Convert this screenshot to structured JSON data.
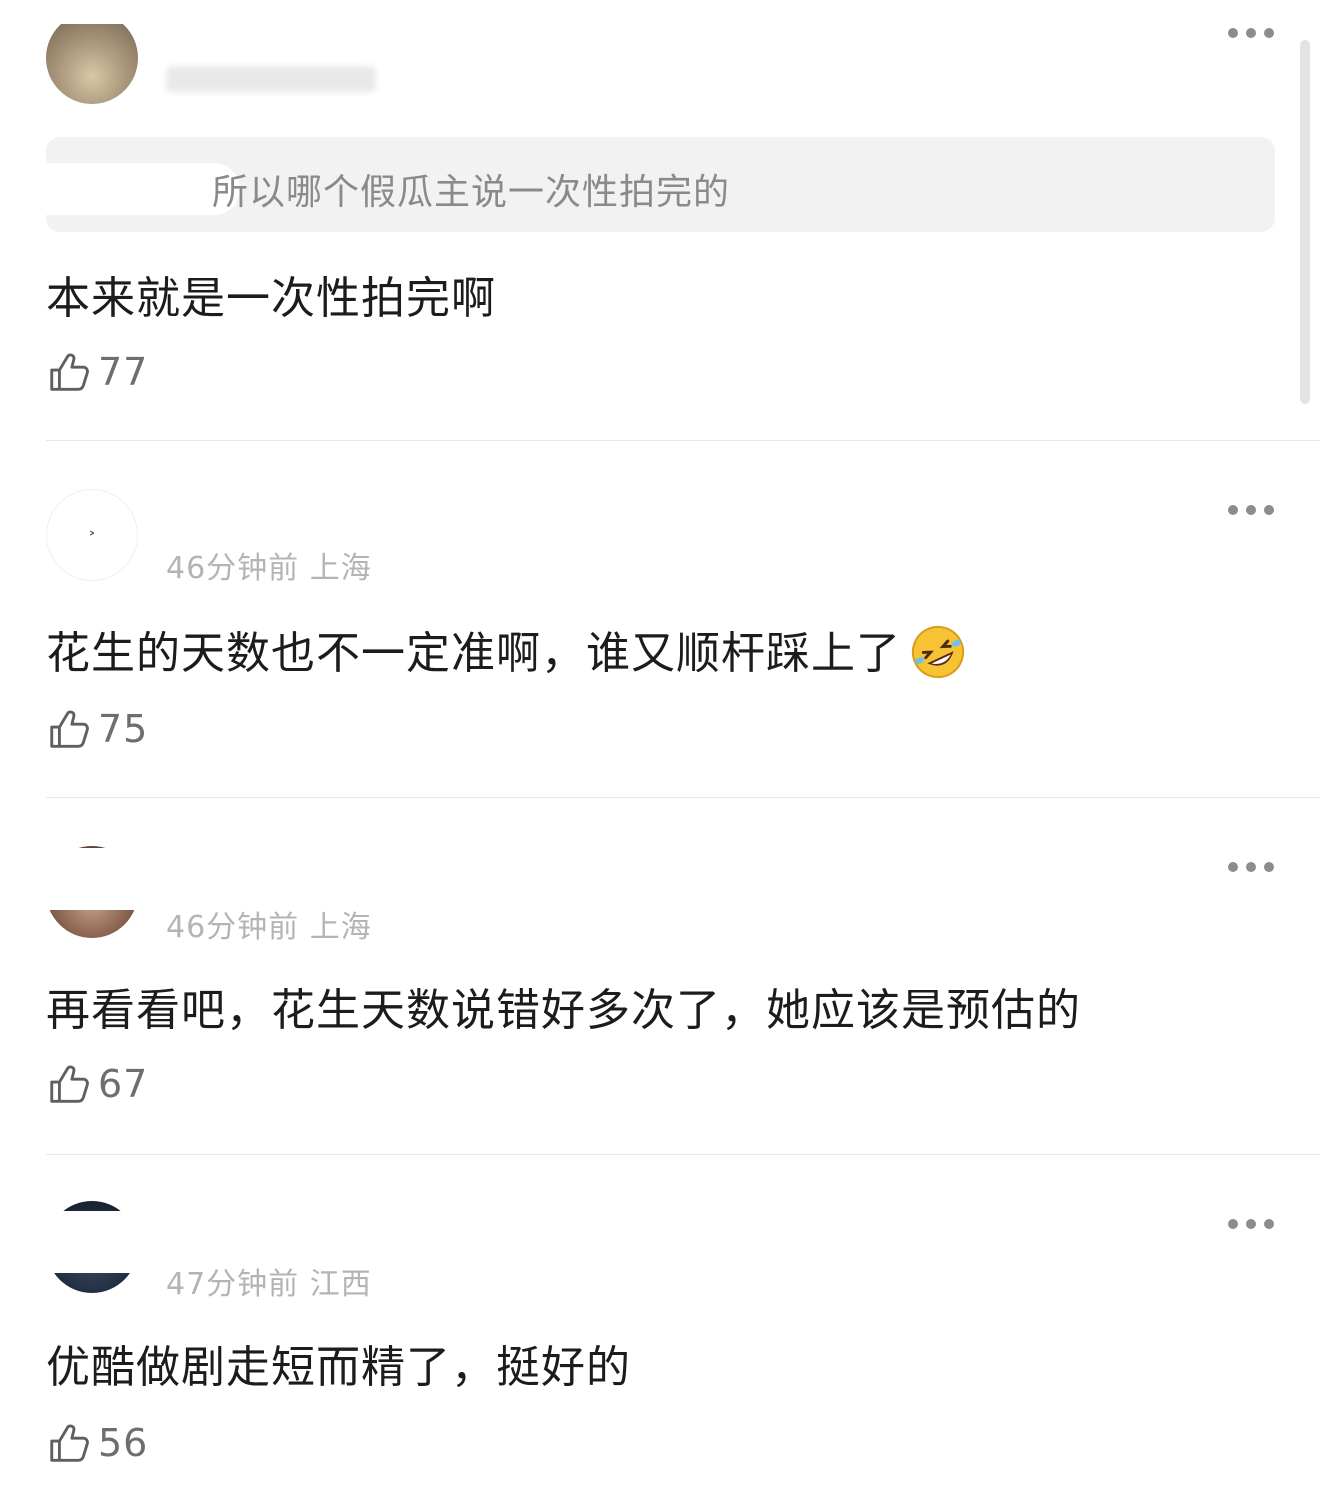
{
  "comments": [
    {
      "time": "",
      "location": "",
      "quoted": "所以哪个假瓜主说一次性拍完的",
      "text": "本来就是一次性拍完啊",
      "likes": "77",
      "avatar_color": "#8a7b6a"
    },
    {
      "time": "46分钟前",
      "location": "上海",
      "text": "花生的天数也不一定准啊，谁又顺杆踩上了",
      "emoji": "rolling-on-floor-laughing-emoji",
      "likes": "75",
      "avatar_color": "#ffffff"
    },
    {
      "time": "46分钟前",
      "location": "上海",
      "text": "再看看吧，花生天数说错好多次了，她应该是预估的",
      "likes": "67",
      "avatar_color": "#4a3a30"
    },
    {
      "time": "47分钟前",
      "location": "江西",
      "text": "优酷做剧走短而精了，挺好的",
      "likes": "56",
      "avatar_color": "#1f2a3c"
    }
  ],
  "icons": {
    "like": "thumbs-up-icon",
    "more": "more-dots-icon"
  },
  "colors": {
    "meta": "#b4b4b4",
    "divider": "#e6e6e6",
    "quote_bg": "#f2f2f2",
    "text": "#1c1c1c"
  }
}
